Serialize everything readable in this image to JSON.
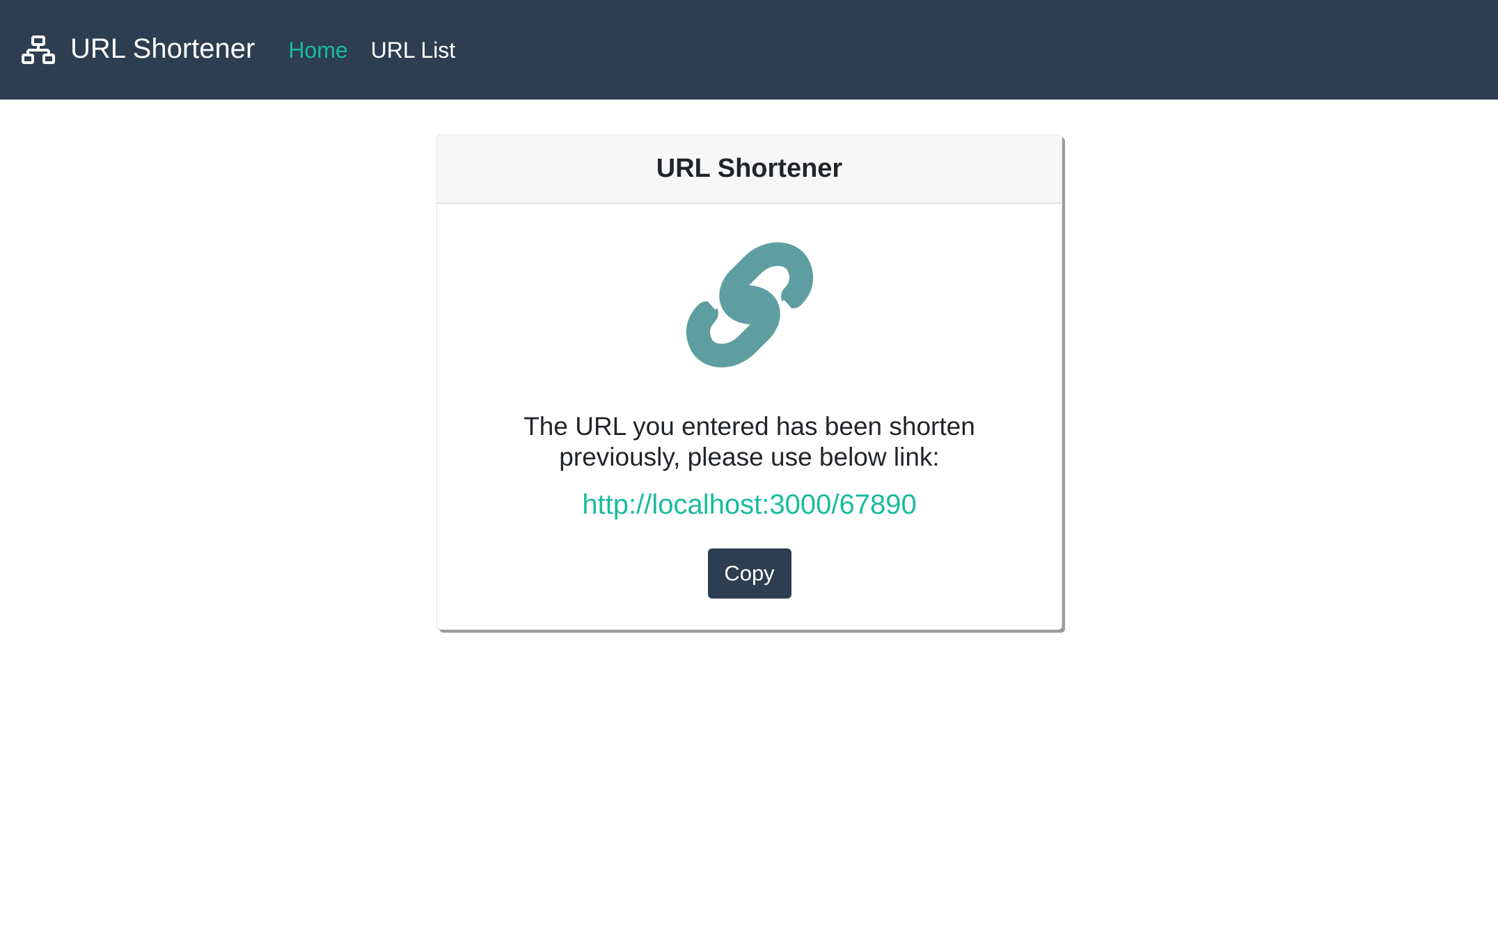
{
  "navbar": {
    "brand_icon": "sitemap-icon",
    "brand_title": "URL Shortener",
    "links": [
      {
        "label": "Home",
        "active": true
      },
      {
        "label": "URL List",
        "active": false
      }
    ],
    "background": "#2c3e50",
    "active_color": "#18bc9c"
  },
  "card": {
    "title": "URL Shortener",
    "icon": "link-icon",
    "icon_color": "#5f9ea0",
    "message": "The URL you entered has been shorten previously, please use below link:",
    "short_url": "http://localhost:3000/67890",
    "link_color": "#18bc9c",
    "copy_label": "Copy"
  }
}
